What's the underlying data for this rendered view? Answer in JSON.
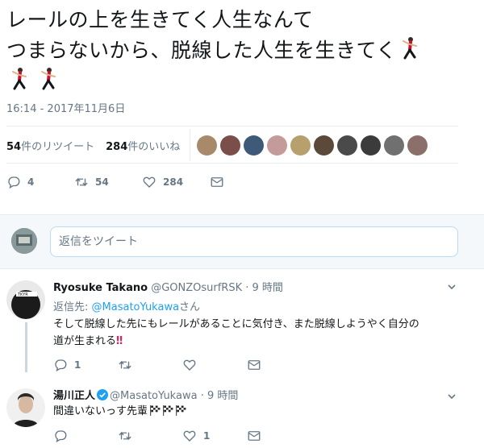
{
  "tweet": {
    "line1": "レールの上を生きてく人生なんて",
    "line2": "つまらないから、脱線した人生を生きてく",
    "timestamp": "16:14 - 2017年11月6日",
    "retweet_count": "54",
    "retweet_label": "件のリツイート",
    "like_count": "284",
    "like_label": "件のいいね",
    "liker_avatar_colors": [
      "#a8896a",
      "#7a4f49",
      "#3e5a78",
      "#c59a9a",
      "#b7a06d",
      "#5b4a3a",
      "#4a4a4a",
      "#3b3b3b",
      "#707070",
      "#8b6f6a"
    ],
    "actions": {
      "reply": "4",
      "retweet": "54",
      "like": "284"
    }
  },
  "reply_box": {
    "placeholder": "返信をツイート"
  },
  "replies": [
    {
      "name": "Ryosuke Takano",
      "handle": "@GONZOsurfRSK",
      "time": "· 9 時間",
      "replying_prefix": "返信先: ",
      "replying_to": "@MasatoYukawa",
      "replying_suffix": "さん",
      "body1": "そして脱線した先にもレールがあることに気付き、また脱線しようやく自分の",
      "body2": "道が生まれる",
      "body2_mark": "‼",
      "actions": {
        "reply": "1",
        "retweet": "",
        "like": ""
      }
    },
    {
      "name": "湯川正人",
      "handle": "@MasatoYukawa",
      "time": "· 9 時間",
      "body1": "間違いないっす先輩",
      "actions": {
        "reply": "",
        "retweet": "",
        "like": "1"
      }
    }
  ],
  "colors": {
    "muted": "#657786",
    "link": "#1da1f2",
    "border": "#e6ecf0",
    "accent": "#e0245e"
  },
  "icons": {
    "reply": "reply-icon",
    "retweet": "retweet-icon",
    "like": "heart-icon",
    "dm": "envelope-icon",
    "more": "chevron-down-icon",
    "verified": "verified-badge-icon",
    "emoji": "dancer-emoji",
    "flag": "checkered-flag-emoji"
  }
}
